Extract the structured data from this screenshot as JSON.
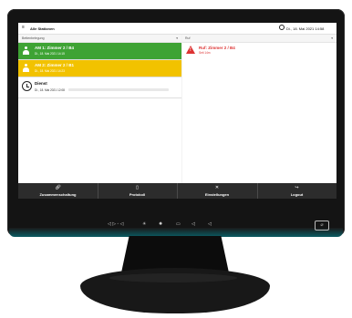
{
  "titlebar": {
    "title": "Alle Stationen",
    "datetime": "Di., 18. Mai 2021 14:58"
  },
  "left_panel": {
    "header": "Bettenbelegung",
    "rows": [
      {
        "name": "AM 1: Zimmer 2 / B4",
        "time": "Di., 18. Mai 2021 14:15",
        "status": "green",
        "icon": "person-icon"
      },
      {
        "name": "AM 2: Zimmer 2 / B1",
        "time": "Di., 18. Mai 2021 14:23",
        "status": "yellow",
        "icon": "group-icon"
      },
      {
        "name": "Dienst",
        "time": "Di., 18. Mai 2021 12:08",
        "status": "white",
        "icon": "clock-icon"
      }
    ]
  },
  "right_panel": {
    "header": "Ruf",
    "alarm": {
      "title": "Ruf: Zimmer 2 / B4",
      "sub": "Seit 14m"
    }
  },
  "toolbar": {
    "items": [
      {
        "label": "Zusammenschaltung",
        "icon": "link-icon"
      },
      {
        "label": "Protokoll",
        "icon": "document-icon"
      },
      {
        "label": "Einstellungen",
        "icon": "tools-icon"
      },
      {
        "label": "Logout",
        "icon": "logout-icon"
      }
    ]
  },
  "bezel": {
    "controls_text": "◁ ▷ ✦ ◁ ⊙",
    "logo": "⌀"
  },
  "colors": {
    "green": "#3ea334",
    "yellow": "#f2c200",
    "alarm_red": "#d33333",
    "toolbar": "#2c2c2c"
  }
}
